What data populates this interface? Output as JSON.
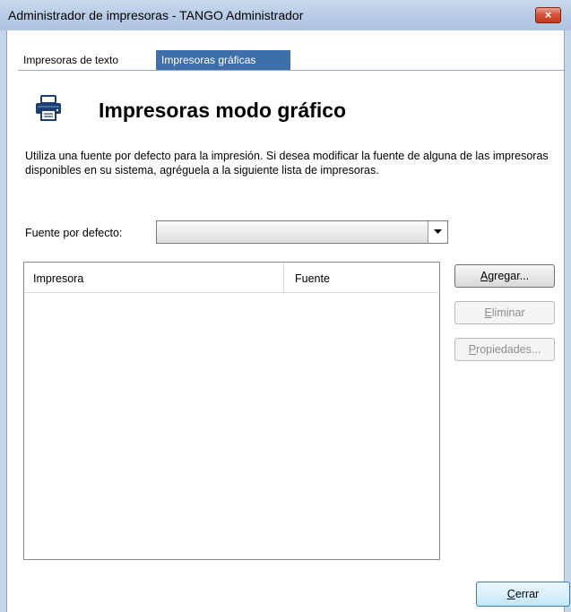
{
  "window": {
    "title": "Administrador de impresoras - TANGO Administrador",
    "close_glyph": "×"
  },
  "tabs": [
    {
      "label": "Impresoras de texto",
      "active": false
    },
    {
      "label": "Impresoras gráficas",
      "active": true
    }
  ],
  "header": {
    "icon": "printer-icon",
    "title": "Impresoras modo gráfico"
  },
  "description": "Utiliza una fuente por defecto para la impresión. Si desea modificar la fuente de alguna de las impresoras disponibles en su sistema, agréguela a la siguiente lista de impresoras.",
  "default_font": {
    "label": "Fuente por defecto:",
    "value": ""
  },
  "printer_list": {
    "columns": [
      "Impresora",
      "Fuente"
    ],
    "rows": []
  },
  "buttons": {
    "add": {
      "mnemonic": "A",
      "rest": "gregar..."
    },
    "delete": {
      "mnemonic": "E",
      "rest": "liminar"
    },
    "properties": {
      "mnemonic": "P",
      "rest": "ropiedades..."
    },
    "close": {
      "mnemonic": "C",
      "rest": "errar"
    }
  },
  "colors": {
    "active_tab": "#3f6fa8",
    "titlebar": "#b9cce6"
  }
}
